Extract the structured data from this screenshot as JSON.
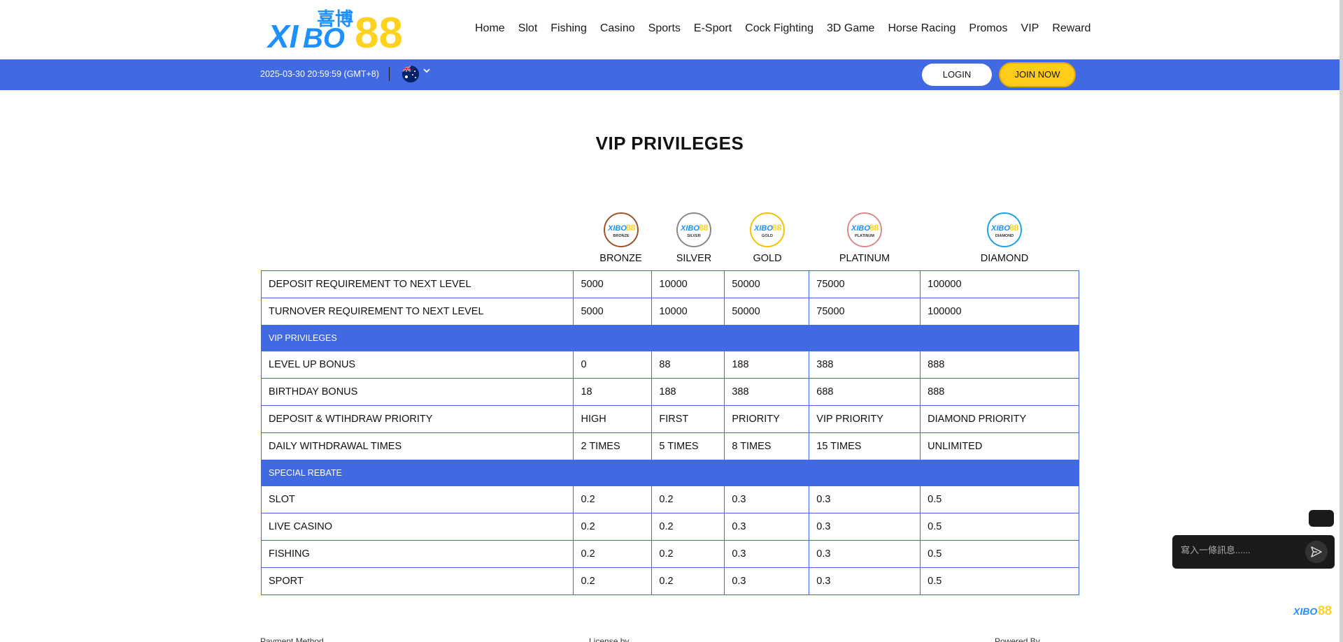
{
  "header": {
    "logo_text": "XIBO88",
    "logo_cn": "喜博",
    "nav": [
      "Home",
      "Slot",
      "Fishing",
      "Casino",
      "Sports",
      "E-Sport",
      "Cock Fighting",
      "3D Game",
      "Horse Racing",
      "Promos",
      "VIP",
      "Reward"
    ]
  },
  "topbar": {
    "datetime": "2025-03-30 20:59:59 (GMT+8)",
    "separator": "|",
    "login_label": "LOGIN",
    "join_label": "JOIN NOW"
  },
  "page_title": "VIP PRIVILEGES",
  "tiers": [
    {
      "name": "BRONZE",
      "badge_label": "BRONZE",
      "color": "#a0522d"
    },
    {
      "name": "SILVER",
      "badge_label": "SILVER",
      "color": "#8a8a8a"
    },
    {
      "name": "GOLD",
      "badge_label": "GOLD",
      "color": "#f2c200"
    },
    {
      "name": "PLATINUM",
      "badge_label": "PLATINUM",
      "color": "#d98c8c"
    },
    {
      "name": "DIAMOND",
      "badge_label": "DIAMOND",
      "color": "#1fa3e0"
    }
  ],
  "table": {
    "rows": [
      {
        "label": "DEPOSIT REQUIREMENT TO NEXT LEVEL",
        "values": [
          "5000",
          "10000",
          "50000",
          "75000",
          "100000"
        ]
      },
      {
        "label": "TURNOVER REQUIREMENT TO NEXT LEVEL",
        "values": [
          "5000",
          "10000",
          "50000",
          "75000",
          "100000"
        ]
      },
      {
        "section": "VIP PRIVILEGES"
      },
      {
        "label": "LEVEL UP BONUS",
        "values": [
          "0",
          "88",
          "188",
          "388",
          "888"
        ]
      },
      {
        "label": "BIRTHDAY BONUS",
        "values": [
          "18",
          "188",
          "388",
          "688",
          "888"
        ]
      },
      {
        "label": "DEPOSIT & WTIHDRAW PRIORITY",
        "values": [
          "HIGH",
          "FIRST",
          "PRIORITY",
          "VIP PRIORITY",
          "DIAMOND PRIORITY"
        ]
      },
      {
        "label": "DAILY WITHDRAWAL TIMES",
        "values": [
          "2 TIMES",
          "5 TIMES",
          "8 TIMES",
          "15 TIMES",
          "UNLIMITED"
        ]
      },
      {
        "section": "SPECIAL REBATE"
      },
      {
        "label": "SLOT",
        "values": [
          "0.2",
          "0.2",
          "0.3",
          "0.3",
          "0.5"
        ]
      },
      {
        "label": "LIVE CASINO",
        "values": [
          "0.2",
          "0.2",
          "0.3",
          "0.3",
          "0.5"
        ]
      },
      {
        "label": "FISHING",
        "values": [
          "0.2",
          "0.2",
          "0.3",
          "0.3",
          "0.5"
        ]
      },
      {
        "label": "SPORT",
        "values": [
          "0.2",
          "0.2",
          "0.3",
          "0.3",
          "0.5"
        ]
      }
    ]
  },
  "footer": {
    "payment_method": "Payment Method",
    "license_by": "License by",
    "powered_by": "Powered By"
  },
  "chat": {
    "placeholder": "寫入一條訊息......",
    "logo_text": "XIBO88"
  },
  "colors": {
    "brand_blue": "#4169e1",
    "join_yellow": "#ffcc1a",
    "chat_dark": "#1a1a1a"
  }
}
